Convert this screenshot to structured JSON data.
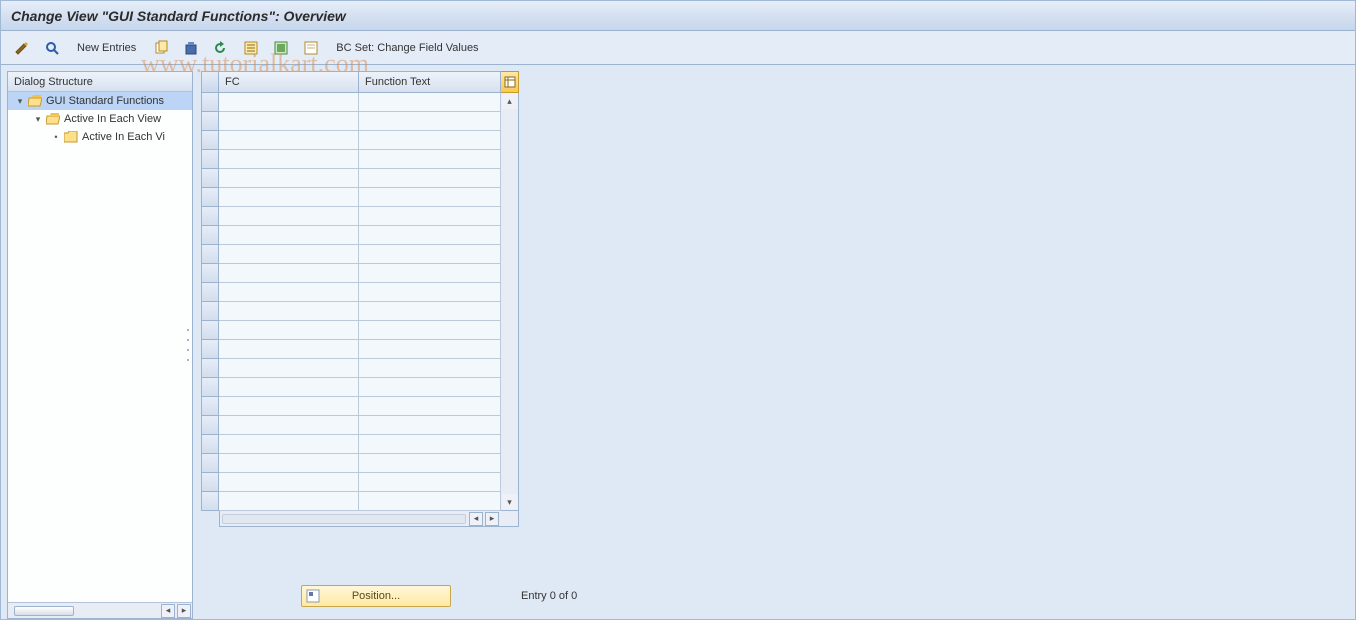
{
  "title": "Change View \"GUI Standard Functions\": Overview",
  "toolbar": {
    "new_entries": "New Entries",
    "bc_set": "BC Set: Change Field Values"
  },
  "dialog_structure": {
    "header": "Dialog Structure",
    "nodes": [
      {
        "label": "GUI Standard Functions",
        "indent": 0,
        "open": true,
        "selected": true,
        "expander": "▾"
      },
      {
        "label": "Active In Each View",
        "indent": 1,
        "open": true,
        "selected": false,
        "expander": "▾"
      },
      {
        "label": "Active In Each Vi",
        "indent": 2,
        "open": false,
        "selected": false,
        "expander": "•"
      }
    ]
  },
  "table": {
    "columns": {
      "fc": "FC",
      "ft": "Function Text"
    },
    "row_count": 22
  },
  "footer": {
    "position_label": "Position...",
    "entry_text": "Entry 0 of 0"
  },
  "watermark": "www.tutorialkart.com"
}
